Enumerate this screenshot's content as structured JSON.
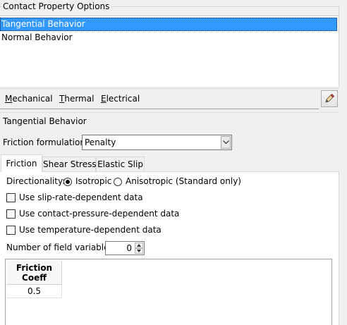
{
  "contact_property_options": {
    "legend": "Contact Property Options",
    "items": [
      {
        "label": "Tangential Behavior",
        "selected": true
      },
      {
        "label": "Normal Behavior",
        "selected": false
      }
    ]
  },
  "menu": {
    "mechanical": {
      "mnemonic": "M",
      "rest": "echanical"
    },
    "thermal": {
      "mnemonic": "T",
      "rest": "hermal"
    },
    "electrical": {
      "mnemonic": "E",
      "rest": "lectrical"
    },
    "edit_icon": "pencil-eraser-icon"
  },
  "tangential_behavior": {
    "title": "Tangential Behavior",
    "friction_formulation_label": "Friction formulation:",
    "friction_formulation_value": "Penalty",
    "tabs": [
      "Friction",
      "Shear Stress",
      "Elastic Slip"
    ],
    "active_tab": "Friction",
    "directionality_label": "Directionality:",
    "directionality_options": [
      "Isotropic",
      "Anisotropic (Standard only)"
    ],
    "directionality_selected": "Isotropic",
    "checkboxes": [
      {
        "label": "Use slip-rate-dependent data",
        "checked": false
      },
      {
        "label": "Use contact-pressure-dependent data",
        "checked": false
      },
      {
        "label": "Use temperature-dependent data",
        "checked": false
      }
    ],
    "field_variables_label": "Number of field variables:",
    "field_variables_value": "0",
    "table": {
      "header_line1": "Friction",
      "header_line2": "Coeff",
      "rows": [
        [
          "0.5"
        ]
      ]
    }
  },
  "colors": {
    "selection": "#3399ff",
    "background": "#f0f0f0"
  }
}
